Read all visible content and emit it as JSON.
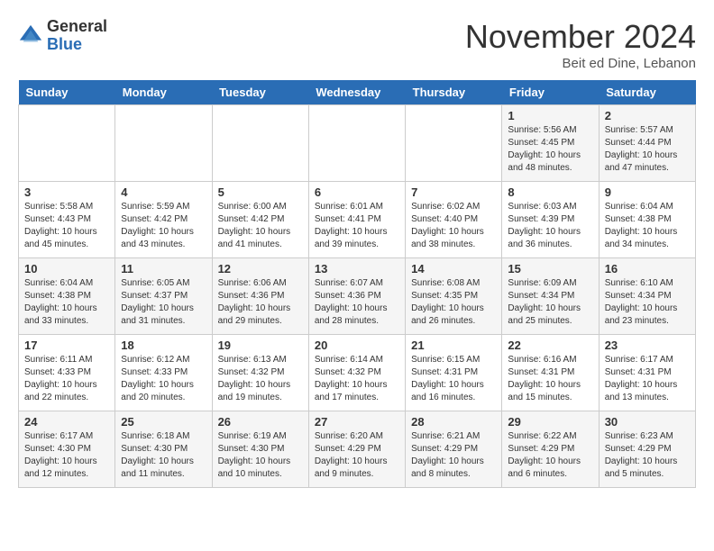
{
  "header": {
    "logo_general": "General",
    "logo_blue": "Blue",
    "month_title": "November 2024",
    "location": "Beit ed Dine, Lebanon"
  },
  "weekdays": [
    "Sunday",
    "Monday",
    "Tuesday",
    "Wednesday",
    "Thursday",
    "Friday",
    "Saturday"
  ],
  "weeks": [
    [
      {
        "day": "",
        "sunrise": "",
        "sunset": "",
        "daylight": ""
      },
      {
        "day": "",
        "sunrise": "",
        "sunset": "",
        "daylight": ""
      },
      {
        "day": "",
        "sunrise": "",
        "sunset": "",
        "daylight": ""
      },
      {
        "day": "",
        "sunrise": "",
        "sunset": "",
        "daylight": ""
      },
      {
        "day": "",
        "sunrise": "",
        "sunset": "",
        "daylight": ""
      },
      {
        "day": "1",
        "sunrise": "Sunrise: 5:56 AM",
        "sunset": "Sunset: 4:45 PM",
        "daylight": "Daylight: 10 hours and 48 minutes."
      },
      {
        "day": "2",
        "sunrise": "Sunrise: 5:57 AM",
        "sunset": "Sunset: 4:44 PM",
        "daylight": "Daylight: 10 hours and 47 minutes."
      }
    ],
    [
      {
        "day": "3",
        "sunrise": "Sunrise: 5:58 AM",
        "sunset": "Sunset: 4:43 PM",
        "daylight": "Daylight: 10 hours and 45 minutes."
      },
      {
        "day": "4",
        "sunrise": "Sunrise: 5:59 AM",
        "sunset": "Sunset: 4:42 PM",
        "daylight": "Daylight: 10 hours and 43 minutes."
      },
      {
        "day": "5",
        "sunrise": "Sunrise: 6:00 AM",
        "sunset": "Sunset: 4:42 PM",
        "daylight": "Daylight: 10 hours and 41 minutes."
      },
      {
        "day": "6",
        "sunrise": "Sunrise: 6:01 AM",
        "sunset": "Sunset: 4:41 PM",
        "daylight": "Daylight: 10 hours and 39 minutes."
      },
      {
        "day": "7",
        "sunrise": "Sunrise: 6:02 AM",
        "sunset": "Sunset: 4:40 PM",
        "daylight": "Daylight: 10 hours and 38 minutes."
      },
      {
        "day": "8",
        "sunrise": "Sunrise: 6:03 AM",
        "sunset": "Sunset: 4:39 PM",
        "daylight": "Daylight: 10 hours and 36 minutes."
      },
      {
        "day": "9",
        "sunrise": "Sunrise: 6:04 AM",
        "sunset": "Sunset: 4:38 PM",
        "daylight": "Daylight: 10 hours and 34 minutes."
      }
    ],
    [
      {
        "day": "10",
        "sunrise": "Sunrise: 6:04 AM",
        "sunset": "Sunset: 4:38 PM",
        "daylight": "Daylight: 10 hours and 33 minutes."
      },
      {
        "day": "11",
        "sunrise": "Sunrise: 6:05 AM",
        "sunset": "Sunset: 4:37 PM",
        "daylight": "Daylight: 10 hours and 31 minutes."
      },
      {
        "day": "12",
        "sunrise": "Sunrise: 6:06 AM",
        "sunset": "Sunset: 4:36 PM",
        "daylight": "Daylight: 10 hours and 29 minutes."
      },
      {
        "day": "13",
        "sunrise": "Sunrise: 6:07 AM",
        "sunset": "Sunset: 4:36 PM",
        "daylight": "Daylight: 10 hours and 28 minutes."
      },
      {
        "day": "14",
        "sunrise": "Sunrise: 6:08 AM",
        "sunset": "Sunset: 4:35 PM",
        "daylight": "Daylight: 10 hours and 26 minutes."
      },
      {
        "day": "15",
        "sunrise": "Sunrise: 6:09 AM",
        "sunset": "Sunset: 4:34 PM",
        "daylight": "Daylight: 10 hours and 25 minutes."
      },
      {
        "day": "16",
        "sunrise": "Sunrise: 6:10 AM",
        "sunset": "Sunset: 4:34 PM",
        "daylight": "Daylight: 10 hours and 23 minutes."
      }
    ],
    [
      {
        "day": "17",
        "sunrise": "Sunrise: 6:11 AM",
        "sunset": "Sunset: 4:33 PM",
        "daylight": "Daylight: 10 hours and 22 minutes."
      },
      {
        "day": "18",
        "sunrise": "Sunrise: 6:12 AM",
        "sunset": "Sunset: 4:33 PM",
        "daylight": "Daylight: 10 hours and 20 minutes."
      },
      {
        "day": "19",
        "sunrise": "Sunrise: 6:13 AM",
        "sunset": "Sunset: 4:32 PM",
        "daylight": "Daylight: 10 hours and 19 minutes."
      },
      {
        "day": "20",
        "sunrise": "Sunrise: 6:14 AM",
        "sunset": "Sunset: 4:32 PM",
        "daylight": "Daylight: 10 hours and 17 minutes."
      },
      {
        "day": "21",
        "sunrise": "Sunrise: 6:15 AM",
        "sunset": "Sunset: 4:31 PM",
        "daylight": "Daylight: 10 hours and 16 minutes."
      },
      {
        "day": "22",
        "sunrise": "Sunrise: 6:16 AM",
        "sunset": "Sunset: 4:31 PM",
        "daylight": "Daylight: 10 hours and 15 minutes."
      },
      {
        "day": "23",
        "sunrise": "Sunrise: 6:17 AM",
        "sunset": "Sunset: 4:31 PM",
        "daylight": "Daylight: 10 hours and 13 minutes."
      }
    ],
    [
      {
        "day": "24",
        "sunrise": "Sunrise: 6:17 AM",
        "sunset": "Sunset: 4:30 PM",
        "daylight": "Daylight: 10 hours and 12 minutes."
      },
      {
        "day": "25",
        "sunrise": "Sunrise: 6:18 AM",
        "sunset": "Sunset: 4:30 PM",
        "daylight": "Daylight: 10 hours and 11 minutes."
      },
      {
        "day": "26",
        "sunrise": "Sunrise: 6:19 AM",
        "sunset": "Sunset: 4:30 PM",
        "daylight": "Daylight: 10 hours and 10 minutes."
      },
      {
        "day": "27",
        "sunrise": "Sunrise: 6:20 AM",
        "sunset": "Sunset: 4:29 PM",
        "daylight": "Daylight: 10 hours and 9 minutes."
      },
      {
        "day": "28",
        "sunrise": "Sunrise: 6:21 AM",
        "sunset": "Sunset: 4:29 PM",
        "daylight": "Daylight: 10 hours and 8 minutes."
      },
      {
        "day": "29",
        "sunrise": "Sunrise: 6:22 AM",
        "sunset": "Sunset: 4:29 PM",
        "daylight": "Daylight: 10 hours and 6 minutes."
      },
      {
        "day": "30",
        "sunrise": "Sunrise: 6:23 AM",
        "sunset": "Sunset: 4:29 PM",
        "daylight": "Daylight: 10 hours and 5 minutes."
      }
    ]
  ]
}
